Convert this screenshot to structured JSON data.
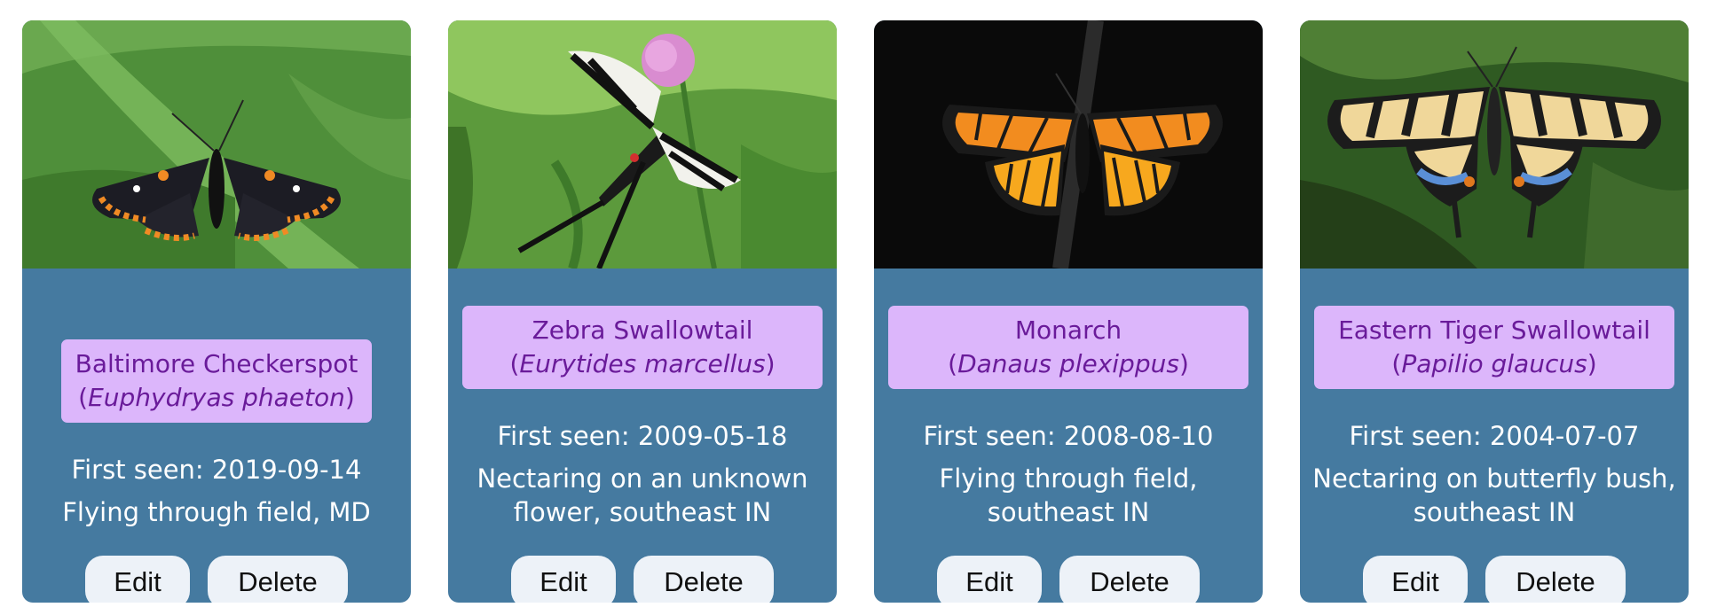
{
  "cards": [
    {
      "common_name": "Baltimore Checkerspot",
      "open_paren": "(",
      "scientific_name": "Euphydryas phaeton",
      "close_paren": ")",
      "first_seen": "First seen: 2019-09-14",
      "note": "Flying through field, MD",
      "edit_label": "Edit",
      "delete_label": "Delete"
    },
    {
      "common_name": "Zebra Swallowtail",
      "open_paren": "(",
      "scientific_name": "Eurytides marcellus",
      "close_paren": ")",
      "first_seen": "First seen: 2009-05-18",
      "note": "Nectaring on an unknown flower, southeast IN",
      "edit_label": "Edit",
      "delete_label": "Delete"
    },
    {
      "common_name": "Monarch",
      "open_paren": "(",
      "scientific_name": "Danaus plexippus",
      "close_paren": ")",
      "first_seen": "First seen: 2008-08-10",
      "note": "Flying through field, southeast IN",
      "edit_label": "Edit",
      "delete_label": "Delete"
    },
    {
      "common_name": "Eastern Tiger Swallowtail",
      "open_paren": "(",
      "scientific_name": "Papilio glaucus",
      "close_paren": ")",
      "first_seen": "First seen: 2004-07-07",
      "note": "Nectaring on butterfly bush, southeast IN",
      "edit_label": "Edit",
      "delete_label": "Delete"
    }
  ],
  "colors": {
    "card_background": "#457aa0",
    "name_background": "#dcb6fb",
    "name_text": "#6a1b9a",
    "button_background": "#edf2f8"
  }
}
